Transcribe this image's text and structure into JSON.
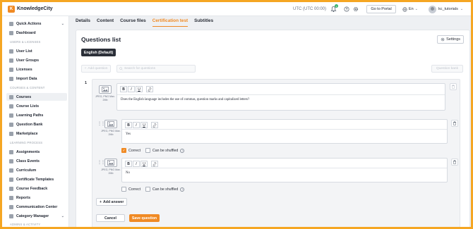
{
  "colors": {
    "accent": "#f08a24",
    "frame": "#f5a623",
    "dark": "#2b2f38"
  },
  "topbar": {
    "brand": "KnowledgeCity",
    "logo_glyph": "K",
    "timezone": "UTC (UTC 00:00)",
    "notifications_count": "2",
    "portal_label": "Go to Portal",
    "language": "En",
    "username": "kc_tutorials"
  },
  "sidebar": {
    "quick_actions": "Quick Actions",
    "dashboard": "Dashboard",
    "section_users": "USERS & LICENSES",
    "user_list": "User List",
    "user_groups": "User Groups",
    "licenses": "Licenses",
    "import_data": "Import Data",
    "section_courses": "COURSES & CONTENT",
    "courses": "Courses",
    "course_lists": "Course Lists",
    "learning_paths": "Learning Paths",
    "question_bank": "Question Bank",
    "marketplace": "Marketplace",
    "section_learning": "LEARNING PROCESS",
    "assignments": "Assignments",
    "class_events": "Class Events",
    "curriculum": "Curriculum",
    "certificate_templates": "Certificate Templates",
    "course_feedback": "Course Feedback",
    "reports": "Reports",
    "communication_center": "Communication Center",
    "category_manager": "Category Manager",
    "section_admin": "ADMINS & ACTIVITY"
  },
  "tabs": {
    "details": "Details",
    "content": "Content",
    "course_files": "Course files",
    "certification_test": "Certification test",
    "subtitles": "Subtitles"
  },
  "main": {
    "title": "Questions list",
    "settings_label": "Settings",
    "language_pill": "English (Default)",
    "add_question": "Add question",
    "search_placeholder": "Search for questions",
    "question_bank": "Question bank",
    "question_number": "1"
  },
  "question": {
    "image_label": "JPEG, PNG Max. 2Mb",
    "text": "Does the English language includes the use of commas, question marks and capitalized letters?"
  },
  "answers": [
    {
      "text": "Yes",
      "correct_label": "Correct",
      "shuffle_label": "Can be shuffled",
      "correct": true,
      "shuffled": false
    },
    {
      "text": "No",
      "correct_label": "Correct",
      "shuffle_label": "Can be shuffled",
      "correct": false,
      "shuffled": false
    }
  ],
  "actions": {
    "add_answer": "Add answer",
    "cancel": "Cancel",
    "save": "Save question"
  }
}
